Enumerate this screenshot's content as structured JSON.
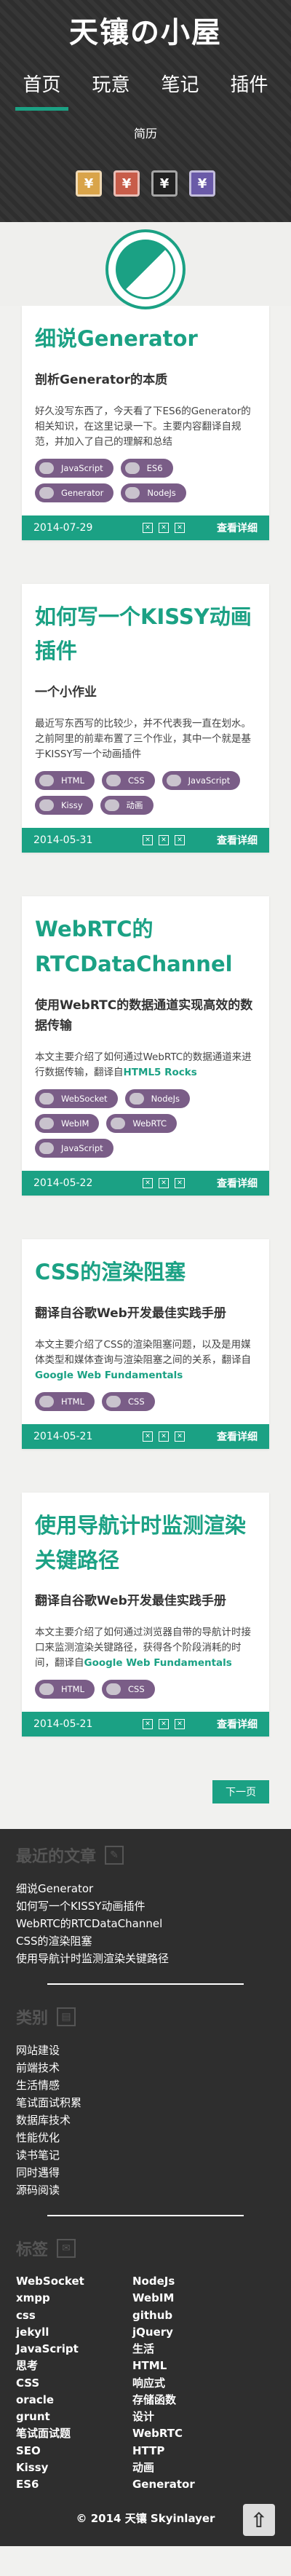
{
  "site": {
    "title": "天镶の小屋"
  },
  "nav": [
    {
      "label": "首页",
      "active": true
    },
    {
      "label": "玩意",
      "active": false
    },
    {
      "label": "笔记",
      "active": false
    },
    {
      "label": "插件",
      "active": false
    },
    {
      "label": "简历",
      "active": false
    }
  ],
  "social_icons": [
    {
      "name": "weibo-icon",
      "glyph": "¥",
      "color": "#d9a44a"
    },
    {
      "name": "douban-icon",
      "glyph": "¥",
      "color": "#c85d4a"
    },
    {
      "name": "github-icon",
      "glyph": "¥",
      "color": "#222222"
    },
    {
      "name": "rss-icon",
      "glyph": "¥",
      "color": "#6a5aa8"
    }
  ],
  "accent_color": "#1ba184",
  "posts": [
    {
      "title": "细说Generator",
      "subtitle": "剖析Generator的本质",
      "summary": "好久没写东西了，今天看了下ES6的Generator的相关知识，在这里记录一下。主要内容翻译自规范，并加入了自己的理解和总结",
      "summary_link": "",
      "tags": [
        "JavaScript",
        "ES6",
        "Generator",
        "NodeJs"
      ],
      "date": "2014-07-29",
      "read_more": "查看详细"
    },
    {
      "title": "如何写一个KISSY动画插件",
      "subtitle": "一个小作业",
      "summary": "最近写东西写的比较少，并不代表我一直在划水。之前阿里的前辈布置了三个作业，其中一个就是基于KISSY写一个动画插件",
      "summary_link": "",
      "tags": [
        "HTML",
        "CSS",
        "JavaScript",
        "Kissy",
        "动画"
      ],
      "date": "2014-05-31",
      "read_more": "查看详细"
    },
    {
      "title": "WebRTC的RTCDataChannel",
      "subtitle": "使用WebRTC的数据通道实现高效的数据传输",
      "summary": "本文主要介绍了如何通过WebRTC的数据通道来进行数据传输，翻译自",
      "summary_link": "HTML5 Rocks",
      "tags": [
        "WebSocket",
        "NodeJs",
        "WebIM",
        "WebRTC",
        "JavaScript"
      ],
      "date": "2014-05-22",
      "read_more": "查看详细"
    },
    {
      "title": "CSS的渲染阻塞",
      "subtitle": "翻译自谷歌Web开发最佳实践手册",
      "summary": "本文主要介绍了CSS的渲染阻塞问题，以及是用媒体类型和媒体查询与渲染阻塞之间的关系，翻译自",
      "summary_link": "Google Web Fundamentals",
      "tags": [
        "HTML",
        "CSS"
      ],
      "date": "2014-05-21",
      "read_more": "查看详细"
    },
    {
      "title": "使用导航计时监测渲染关键路径",
      "subtitle": "翻译自谷歌Web开发最佳实践手册",
      "summary": "本文主要介绍了如何通过浏览器自带的导航计时接口来监测渲染关键路径，获得各个阶段消耗的时间，翻译自",
      "summary_link": "Google Web Fundamentals",
      "tags": [
        "HTML",
        "CSS"
      ],
      "date": "2014-05-21",
      "read_more": "查看详细"
    }
  ],
  "pagination": {
    "next": "下一页"
  },
  "recent": {
    "title": "最近的文章",
    "items": [
      "细说Generator",
      "如何写一个KISSY动画插件",
      "WebRTC的RTCDataChannel",
      "CSS的渲染阻塞",
      "使用导航计时监测渲染关键路径"
    ]
  },
  "categories": {
    "title": "类别",
    "items": [
      "网站建设",
      "前端技术",
      "生活情感",
      "笔试面试积累",
      "数据库技术",
      "性能优化",
      "读书笔记",
      "同时遇得",
      "源码阅读"
    ]
  },
  "tags_cloud": {
    "title": "标签",
    "items": [
      "WebSocket",
      "NodeJs",
      "xmpp",
      "WebIM",
      "css",
      "github",
      "jekyll",
      "jQuery",
      "JavaScript",
      "生活",
      "思考",
      "HTML",
      "CSS",
      "响应式",
      "oracle",
      "存储函数",
      "grunt",
      "设计",
      "笔试面试题",
      "WebRTC",
      "SEO",
      "HTTP",
      "Kissy",
      "动画",
      "ES6",
      "Generator"
    ]
  },
  "footer": {
    "copyright": "© 2014 天镶 Skyinlayer",
    "top_glyph": "⇧"
  }
}
